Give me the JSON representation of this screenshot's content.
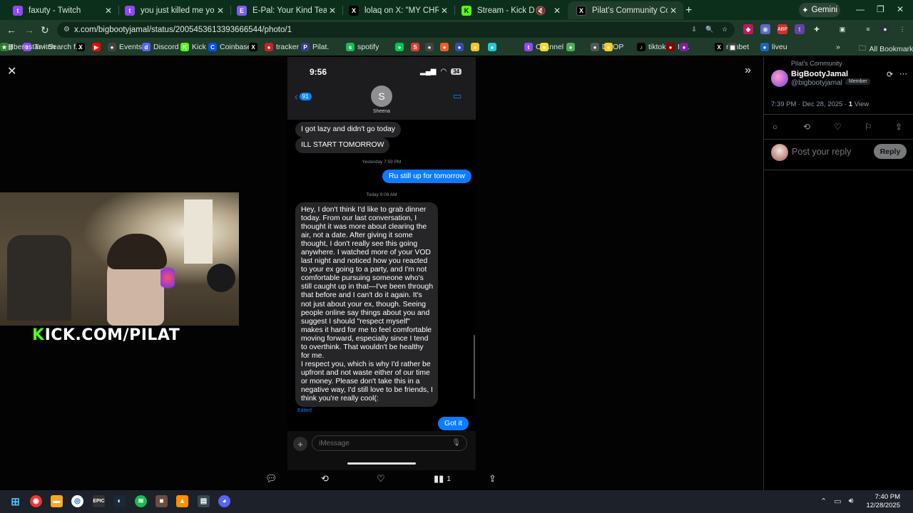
{
  "browser": {
    "tabs": [
      {
        "label": "faxuty - Twitch",
        "icon": "twitch-icon",
        "color": "#9146ff",
        "glyph": "t"
      },
      {
        "label": "you just killed me you - Twitch",
        "icon": "twitch-icon",
        "color": "#9146ff",
        "glyph": "t"
      },
      {
        "label": "E-Pal: Your Kind Teammates",
        "icon": "epal-icon",
        "color": "#7b5cff",
        "glyph": "E"
      },
      {
        "label": "lolaq on X: \"MY CHRISTMAS GI",
        "icon": "x-icon",
        "color": "#000000",
        "glyph": "X"
      },
      {
        "label": "Stream - Kick Dashboard",
        "icon": "kick-icon",
        "color": "#53fc18",
        "glyph": "K"
      },
      {
        "label": "Pilat's Community Community",
        "icon": "x-icon",
        "color": "#000000",
        "glyph": "X"
      }
    ],
    "new_tab": "+",
    "gemini": "Gemini",
    "url": "x.com/bigbootyjamal/status/2005453613393666544/photo/1",
    "bookmarks": [
      {
        "label": "Twitch",
        "color": "#9146ff",
        "glyph": "t"
      },
      {
        "label": "",
        "color": "#000000",
        "glyph": "X"
      },
      {
        "label": "",
        "color": "#ff0000",
        "glyph": "▶"
      },
      {
        "label": "Events",
        "color": "#444444",
        "glyph": "●"
      },
      {
        "label": "Discord",
        "color": "#5865f2",
        "glyph": "d"
      },
      {
        "label": "Kick",
        "color": "#53fc18",
        "glyph": "K"
      },
      {
        "label": "Coinbase",
        "color": "#0052ff",
        "glyph": "C"
      },
      {
        "label": "",
        "color": "#000000",
        "glyph": "X"
      },
      {
        "label": "tracker",
        "color": "#cc2222",
        "glyph": "●"
      },
      {
        "label": "Pilat.",
        "color": "#3a3a8a",
        "glyph": "P"
      },
      {
        "label": "spotify",
        "color": "#1db954",
        "glyph": "s"
      },
      {
        "label": "",
        "color": "#00c853",
        "glyph": "●"
      },
      {
        "label": "",
        "color": "#e53935",
        "glyph": "S"
      },
      {
        "label": "",
        "color": "#444444",
        "glyph": "●"
      },
      {
        "label": "",
        "color": "#ff5722",
        "glyph": "●"
      },
      {
        "label": "",
        "color": "#3949ab",
        "glyph": "●"
      },
      {
        "label": "",
        "color": "#fbc02d",
        "glyph": "●"
      },
      {
        "label": "",
        "color": "#26c6da",
        "glyph": "●"
      },
      {
        "label": "Channel",
        "color": "#9146ff",
        "glyph": "t"
      },
      {
        "label": "",
        "color": "#fdd835",
        "glyph": "●"
      },
      {
        "label": "",
        "color": "#4caf50",
        "glyph": "●"
      },
      {
        "label": "DROP",
        "color": "#555555",
        "glyph": "●"
      },
      {
        "label": "",
        "color": "#ffca28",
        "glyph": "●"
      },
      {
        "label": "tiktok",
        "color": "#000000",
        "glyph": "♪"
      },
      {
        "label": "IRL",
        "color": "#8b0000",
        "glyph": "●"
      },
      {
        "label": "",
        "color": "#7b1fa2",
        "glyph": "●"
      },
      {
        "label": "rainbet",
        "color": "#000000",
        "glyph": "X"
      },
      {
        "label": "",
        "color": "#424242",
        "glyph": "▦"
      },
      {
        "label": "liveu",
        "color": "#1565c0",
        "glyph": "●"
      },
      {
        "label": "Iberostar - Search f...",
        "color": "#2e7d32",
        "glyph": "★"
      }
    ],
    "bookmarks_more": "»",
    "all_bookmarks": "All Bookmarks"
  },
  "phone": {
    "time": "9:56",
    "battery": "34",
    "back_count": "91",
    "contact_initial": "S",
    "contact_name": "Sheena",
    "messages_top": [
      "I got lazy and didn't go today",
      "ILL START TOMORROW"
    ],
    "ts_yesterday": "Yesterday 7:59 PM",
    "out_1": "Ru still up for tomorrow",
    "ts_today": "Today 9:09 AM",
    "long_message_lines": [
      "Hey, I don't think I'd like to grab dinner",
      "today. From our last conversation, I",
      "thought it was more about clearing the",
      "air, not a date. After giving it some",
      "thought, I don't really see this going",
      "anywhere. I watched more of your VOD",
      "last night and noticed how you reacted",
      "to your ex going to a party, and I'm not",
      "comfortable pursuing someone who's",
      "still caught up in that—I've been through",
      "that before and I can't do it again. It's",
      "not just about your ex, though. Seeing",
      "people online say things about you and",
      "suggest I should \"respect myself\"",
      "makes it hard for me to feel comfortable",
      "moving forward, especially since I tend",
      "to overthink. That wouldn't be healthy",
      "for me.",
      "I respect you, which is why I'd rather be",
      "upfront and not waste either of our time",
      "or money. Please don't take this in a",
      "negative way, I'd still love to be friends, I",
      "think you're really cool(:"
    ],
    "edited": "Edited",
    "out_2": "Got it",
    "composer_placeholder": "iMessage"
  },
  "stream_overlay": {
    "brand_k": "K",
    "brand_rest": "ICK.COM/PILAT"
  },
  "post_actions": {
    "reply": "",
    "repost": "",
    "like": "",
    "views_count": "1",
    "share": ""
  },
  "post": {
    "community": "Pilat's Community",
    "author_name": "BigBootyJamal",
    "author_handle": "@bigbootyjamal ·",
    "member_badge": "Member",
    "meta_time": "7:39 PM · Dec 28, 2025 · ",
    "meta_views_count": "1",
    "meta_views_label": " View",
    "reply_placeholder": "Post your reply",
    "reply_button": "Reply"
  },
  "taskbar": {
    "time": "7:40 PM",
    "date": "12/28/2025"
  },
  "colors": {
    "imessage_blue": "#0a7cff",
    "kick_green": "#53fc18",
    "chrome_tab_bg": "#0c2f1c"
  }
}
